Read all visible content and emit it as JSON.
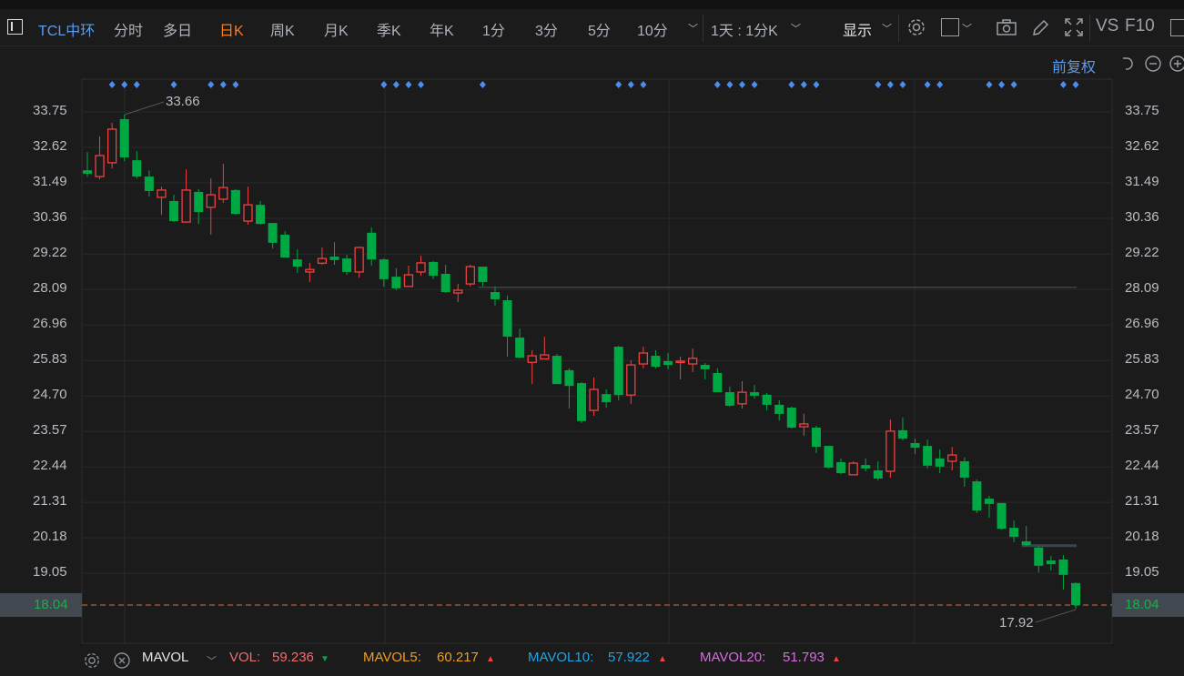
{
  "toolbar": {
    "stock_name": "TCL中环",
    "periods": [
      "分时",
      "多日",
      "日K",
      "周K",
      "月K",
      "季K",
      "年K",
      "1分",
      "3分",
      "5分",
      "10分"
    ],
    "active_period": "日K",
    "interval_select": "1天 : 1分K",
    "display_label": "显示",
    "vs_label": "VS",
    "f10_label": "F10",
    "adjust_label": "前复权"
  },
  "bottom": {
    "indicator": "MAVOL",
    "vol_label": "VOL:",
    "vol_value": "59.236",
    "vol_dir": "▼",
    "ma5_label": "MAVOL5:",
    "ma5_value": "60.217",
    "ma5_dir": "▲",
    "ma10_label": "MAVOL10:",
    "ma10_value": "57.922",
    "ma10_dir": "▲",
    "ma20_label": "MAVOL20:",
    "ma20_value": "51.793",
    "ma20_dir": "▲"
  },
  "colors": {
    "up": "#f04040",
    "down": "#00a844",
    "accent": "#5b9cf0",
    "active": "#ff7a1a",
    "marker": "#4a8ef0",
    "vol": "#f36c6c",
    "ma5": "#f39c1f",
    "ma10": "#1ea5e6",
    "ma20": "#d66ee0"
  },
  "chart_data": {
    "type": "candlestick",
    "ylim": [
      17.7,
      34.6
    ],
    "yticks": [
      "33.75",
      "32.62",
      "31.49",
      "30.36",
      "29.22",
      "28.09",
      "26.96",
      "25.83",
      "24.70",
      "23.57",
      "22.44",
      "21.31",
      "20.18",
      "19.05"
    ],
    "last_price": "18.04",
    "max_label": "33.66",
    "min_label": "17.92",
    "ohlc": [
      [
        31.89,
        32.47,
        31.69,
        31.78
      ],
      [
        31.69,
        32.97,
        31.6,
        32.36
      ],
      [
        32.13,
        33.4,
        31.95,
        33.2
      ],
      [
        33.52,
        33.66,
        32.18,
        32.3
      ],
      [
        32.21,
        32.5,
        31.63,
        31.69
      ],
      [
        31.69,
        31.89,
        31.05,
        31.23
      ],
      [
        31.03,
        31.37,
        30.47,
        31.26
      ],
      [
        30.91,
        31.11,
        30.24,
        30.27
      ],
      [
        30.24,
        31.92,
        30.24,
        31.26
      ],
      [
        31.2,
        31.29,
        30.18,
        30.56
      ],
      [
        30.71,
        31.63,
        29.84,
        31.11
      ],
      [
        30.97,
        32.1,
        30.85,
        31.34
      ],
      [
        31.26,
        31.29,
        30.47,
        30.5
      ],
      [
        30.27,
        31.37,
        30.16,
        30.79
      ],
      [
        30.79,
        30.91,
        30.16,
        30.18
      ],
      [
        30.21,
        30.21,
        29.4,
        29.58
      ],
      [
        29.84,
        29.95,
        29.11,
        29.11
      ],
      [
        29.05,
        29.37,
        28.62,
        28.82
      ],
      [
        28.65,
        28.94,
        28.33,
        28.73
      ],
      [
        28.93,
        29.43,
        28.88,
        29.08
      ],
      [
        29.14,
        29.6,
        28.88,
        29.03
      ],
      [
        29.08,
        29.2,
        28.56,
        28.65
      ],
      [
        28.65,
        29.46,
        28.47,
        29.43
      ],
      [
        29.9,
        30.07,
        28.85,
        29.05
      ],
      [
        29.05,
        29.08,
        28.18,
        28.42
      ],
      [
        28.5,
        28.77,
        28.07,
        28.13
      ],
      [
        28.19,
        28.85,
        28.19,
        28.56
      ],
      [
        28.65,
        29.17,
        28.53,
        28.94
      ],
      [
        28.97,
        29.0,
        28.42,
        28.53
      ],
      [
        28.59,
        28.88,
        27.98,
        28.01
      ],
      [
        27.98,
        28.27,
        27.69,
        28.07
      ],
      [
        28.27,
        28.88,
        28.19,
        28.82
      ],
      [
        28.82,
        28.82,
        28.19,
        28.33
      ],
      [
        28.01,
        28.19,
        27.58,
        27.78
      ],
      [
        27.75,
        27.9,
        25.95,
        26.59
      ],
      [
        26.56,
        26.85,
        25.9,
        25.92
      ],
      [
        25.77,
        26.16,
        25.08,
        25.98
      ],
      [
        25.88,
        26.59,
        25.9,
        26.01
      ],
      [
        25.98,
        26.04,
        25.08,
        25.08
      ],
      [
        25.52,
        25.58,
        24.3,
        25.02
      ],
      [
        25.11,
        25.14,
        23.84,
        23.9
      ],
      [
        24.24,
        25.29,
        24.07,
        24.91
      ],
      [
        24.76,
        24.91,
        24.33,
        24.5
      ],
      [
        26.27,
        26.3,
        24.56,
        24.73
      ],
      [
        24.73,
        25.84,
        24.45,
        25.69
      ],
      [
        25.72,
        26.27,
        25.58,
        26.07
      ],
      [
        25.98,
        26.16,
        25.58,
        25.63
      ],
      [
        25.81,
        26.07,
        25.55,
        25.69
      ],
      [
        25.8,
        25.95,
        25.23,
        25.81
      ],
      [
        25.72,
        26.21,
        25.46,
        25.9
      ],
      [
        25.69,
        25.75,
        25.23,
        25.55
      ],
      [
        25.43,
        25.58,
        24.82,
        24.82
      ],
      [
        24.82,
        25.0,
        24.36,
        24.39
      ],
      [
        24.45,
        25.17,
        24.3,
        24.82
      ],
      [
        24.82,
        25.05,
        24.62,
        24.71
      ],
      [
        24.74,
        24.8,
        24.24,
        24.42
      ],
      [
        24.42,
        24.56,
        23.92,
        24.13
      ],
      [
        24.33,
        24.36,
        23.66,
        23.69
      ],
      [
        23.72,
        24.13,
        23.43,
        23.81
      ],
      [
        23.69,
        23.75,
        22.88,
        23.08
      ],
      [
        23.11,
        23.11,
        22.39,
        22.42
      ],
      [
        22.59,
        22.71,
        22.21,
        22.24
      ],
      [
        22.19,
        22.62,
        22.19,
        22.56
      ],
      [
        22.5,
        22.71,
        22.3,
        22.39
      ],
      [
        22.33,
        22.62,
        22.01,
        22.07
      ],
      [
        22.3,
        23.95,
        22.1,
        23.58
      ],
      [
        23.61,
        24.01,
        23.29,
        23.34
      ],
      [
        23.2,
        23.34,
        22.85,
        23.05
      ],
      [
        23.11,
        23.31,
        22.39,
        22.48
      ],
      [
        22.71,
        23.0,
        22.24,
        22.45
      ],
      [
        22.62,
        23.08,
        22.33,
        22.82
      ],
      [
        22.62,
        22.74,
        21.81,
        22.1
      ],
      [
        21.98,
        22.04,
        20.97,
        21.05
      ],
      [
        21.43,
        21.52,
        20.82,
        21.26
      ],
      [
        21.29,
        21.29,
        20.44,
        20.47
      ],
      [
        20.5,
        20.73,
        20.04,
        20.21
      ],
      [
        20.07,
        20.56,
        19.92,
        19.95
      ],
      [
        19.87,
        19.9,
        19.08,
        19.29
      ],
      [
        19.46,
        19.6,
        19.14,
        19.34
      ],
      [
        19.49,
        19.63,
        18.53,
        19.0
      ],
      [
        18.74,
        18.77,
        17.92,
        18.04
      ]
    ],
    "signal_markers": [
      2,
      3,
      4,
      7,
      10,
      11,
      12,
      24,
      25,
      26,
      27,
      32,
      43,
      44,
      45,
      51,
      52,
      53,
      54,
      57,
      58,
      59,
      64,
      65,
      66,
      68,
      69,
      73,
      74,
      75,
      79,
      80
    ],
    "level_lines": [
      {
        "price": 28.16,
        "from": 32,
        "to": 80
      },
      {
        "price": 19.93,
        "from": 76,
        "to": 80
      }
    ]
  }
}
